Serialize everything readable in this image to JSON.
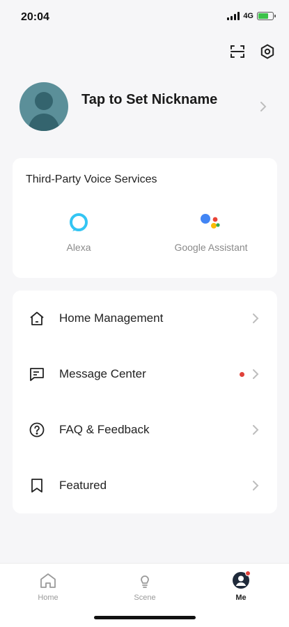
{
  "status_bar": {
    "time": "20:04",
    "network": "4G"
  },
  "top_actions": {
    "scan_icon": "scan-icon",
    "settings_icon": "hexagon-settings-icon"
  },
  "profile": {
    "nickname": "Tap to Set Nickname",
    "avatar_color": "#5b8f99"
  },
  "voice_services": {
    "title": "Third-Party Voice Services",
    "items": [
      {
        "label": "Alexa",
        "icon": "alexa-icon",
        "color": "#33c5f3"
      },
      {
        "label": "Google Assistant",
        "icon": "google-assistant-icon"
      }
    ]
  },
  "menu": {
    "items": [
      {
        "label": "Home Management",
        "icon": "house-icon",
        "has_badge": false
      },
      {
        "label": "Message Center",
        "icon": "message-icon",
        "has_badge": true
      },
      {
        "label": "FAQ & Feedback",
        "icon": "question-circle-icon",
        "has_badge": false
      },
      {
        "label": "Featured",
        "icon": "bookmark-icon",
        "has_badge": false
      }
    ]
  },
  "tab_bar": {
    "tabs": [
      {
        "label": "Home",
        "icon": "home-tab-icon",
        "active": false
      },
      {
        "label": "Scene",
        "icon": "lightbulb-icon",
        "active": false
      },
      {
        "label": "Me",
        "icon": "me-avatar-icon",
        "active": true
      }
    ]
  },
  "colors": {
    "accent_red": "#e0413a",
    "battery_green": "#3cc24a",
    "background": "#f6f6f8"
  }
}
